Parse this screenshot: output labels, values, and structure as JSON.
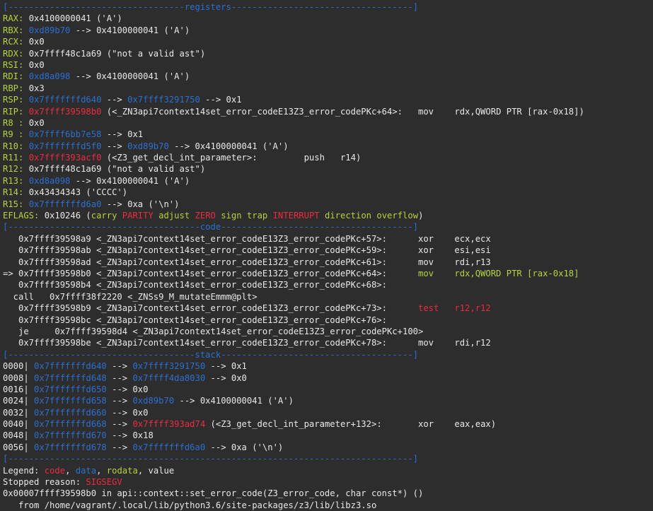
{
  "colors": {
    "blue": "#2c6fd1",
    "green": "#b5d33a",
    "red": "#ef2a3f",
    "white": "#e8e8e8",
    "background": "#2d2d2d"
  },
  "sections": {
    "registers": "registers",
    "code": "code",
    "stack": "stack"
  },
  "registers": [
    {
      "name": "RAX:",
      "segs": [
        {
          "c": "w",
          "t": " 0x4100000041 ('A')"
        }
      ]
    },
    {
      "name": "RBX:",
      "segs": [
        {
          "c": "b",
          "t": " 0xd89b70"
        },
        {
          "c": "w",
          "t": " --> 0x4100000041 ('A')"
        }
      ]
    },
    {
      "name": "RCX:",
      "segs": [
        {
          "c": "w",
          "t": " 0x0"
        }
      ]
    },
    {
      "name": "RDX:",
      "segs": [
        {
          "c": "w",
          "t": " 0x7ffff48c1a69 (\"not a valid ast\")"
        }
      ]
    },
    {
      "name": "RSI:",
      "segs": [
        {
          "c": "w",
          "t": " 0x0"
        }
      ]
    },
    {
      "name": "RDI:",
      "segs": [
        {
          "c": "b",
          "t": " 0xd8a098"
        },
        {
          "c": "w",
          "t": " --> 0x4100000041 ('A')"
        }
      ]
    },
    {
      "name": "RBP:",
      "segs": [
        {
          "c": "w",
          "t": " 0x3"
        }
      ]
    },
    {
      "name": "RSP:",
      "segs": [
        {
          "c": "b",
          "t": " 0x7fffffffd640"
        },
        {
          "c": "w",
          "t": " --> "
        },
        {
          "c": "b",
          "t": "0x7ffff3291750"
        },
        {
          "c": "w",
          "t": " --> 0x1"
        }
      ]
    },
    {
      "name": "RIP:",
      "segs": [
        {
          "c": "r",
          "t": " 0x7ffff39598b0"
        },
        {
          "c": "w",
          "t": " (<_ZN3api7context14set_error_codeE13Z3_error_codePKc+64>:   mov    rdx,QWORD PTR [rax-0x18])"
        }
      ]
    },
    {
      "name": "R8 :",
      "segs": [
        {
          "c": "w",
          "t": " 0x0"
        }
      ]
    },
    {
      "name": "R9 :",
      "segs": [
        {
          "c": "b",
          "t": " 0x7ffff6bb7e58"
        },
        {
          "c": "w",
          "t": " --> 0x1"
        }
      ]
    },
    {
      "name": "R10:",
      "segs": [
        {
          "c": "b",
          "t": " 0x7fffffffd5f0"
        },
        {
          "c": "w",
          "t": " --> "
        },
        {
          "c": "b",
          "t": "0xd89b70"
        },
        {
          "c": "w",
          "t": " --> 0x4100000041 ('A')"
        }
      ]
    },
    {
      "name": "R11:",
      "segs": [
        {
          "c": "r",
          "t": " 0x7ffff393acf0"
        },
        {
          "c": "w",
          "t": " (<Z3_get_decl_int_parameter>:         push   r14)"
        }
      ]
    },
    {
      "name": "R12:",
      "segs": [
        {
          "c": "w",
          "t": " 0x7ffff48c1a69 (\"not a valid ast\")"
        }
      ]
    },
    {
      "name": "R13:",
      "segs": [
        {
          "c": "b",
          "t": " 0xd8a098"
        },
        {
          "c": "w",
          "t": " --> 0x4100000041 ('A')"
        }
      ]
    },
    {
      "name": "R14:",
      "segs": [
        {
          "c": "w",
          "t": " 0x43434343 ('CCCC')"
        }
      ]
    },
    {
      "name": "R15:",
      "segs": [
        {
          "c": "b",
          "t": " 0x7fffffffd6a0"
        },
        {
          "c": "w",
          "t": " --> 0xa ('\\n')"
        }
      ]
    },
    {
      "name": "EFLAGS:",
      "segs": [
        {
          "c": "w",
          "t": " 0x10246 ("
        },
        {
          "c": "g",
          "t": "carry "
        },
        {
          "c": "r",
          "t": "PARITY"
        },
        {
          "c": "g",
          "t": " adjust "
        },
        {
          "c": "r",
          "t": "ZERO"
        },
        {
          "c": "g",
          "t": " sign trap "
        },
        {
          "c": "r",
          "t": "INTERRUPT"
        },
        {
          "c": "g",
          "t": " direction overflow"
        },
        {
          "c": "w",
          "t": ")"
        }
      ]
    }
  ],
  "code": [
    {
      "segs": [
        {
          "c": "w",
          "t": "   0x7ffff39598a9 <_ZN3api7context14set_error_codeE13Z3_error_codePKc+57>:      xor    ecx,ecx"
        }
      ]
    },
    {
      "segs": [
        {
          "c": "w",
          "t": "   0x7ffff39598ab <_ZN3api7context14set_error_codeE13Z3_error_codePKc+59>:      xor    esi,esi"
        }
      ]
    },
    {
      "segs": [
        {
          "c": "w",
          "t": "   0x7ffff39598ad <_ZN3api7context14set_error_codeE13Z3_error_codePKc+61>:      mov    rdi,r13"
        }
      ]
    },
    {
      "segs": [
        {
          "c": "w",
          "t": "=> 0x7ffff39598b0 <_ZN3api7context14set_error_codeE13Z3_error_codePKc+64>:      "
        },
        {
          "c": "g",
          "t": "mov    rdx,QWORD PTR [rax-0x18]"
        }
      ]
    },
    {
      "segs": [
        {
          "c": "w",
          "t": "   0x7ffff39598b4 <_ZN3api7context14set_error_codeE13Z3_error_codePKc+68>:"
        }
      ]
    },
    {
      "segs": [
        {
          "c": "w",
          "t": "  call   0x7ffff38f2220 <_ZNSs9_M_mutateEmmm@plt>"
        }
      ]
    },
    {
      "segs": [
        {
          "c": "w",
          "t": "   0x7ffff39598b9 <_ZN3api7context14set_error_codeE13Z3_error_codePKc+73>:      "
        },
        {
          "c": "r",
          "t": "test   r12,r12"
        }
      ]
    },
    {
      "segs": [
        {
          "c": "w",
          "t": "   0x7ffff39598bc <_ZN3api7context14set_error_codeE13Z3_error_codePKc+76>:"
        }
      ]
    },
    {
      "segs": [
        {
          "c": "w",
          "t": "   je     0x7ffff39598d4 <_ZN3api7context14set_error_codeE13Z3_error_codePKc+100>"
        }
      ]
    },
    {
      "segs": [
        {
          "c": "w",
          "t": "   0x7ffff39598be <_ZN3api7context14set_error_codeE13Z3_error_codePKc+78>:      mov    rdi,r12"
        }
      ]
    }
  ],
  "stack": [
    {
      "segs": [
        {
          "c": "w",
          "t": "0000| "
        },
        {
          "c": "b",
          "t": "0x7fffffffd640"
        },
        {
          "c": "w",
          "t": " --> "
        },
        {
          "c": "b",
          "t": "0x7ffff3291750"
        },
        {
          "c": "w",
          "t": " --> 0x1"
        }
      ]
    },
    {
      "segs": [
        {
          "c": "w",
          "t": "0008| "
        },
        {
          "c": "b",
          "t": "0x7fffffffd648"
        },
        {
          "c": "w",
          "t": " --> "
        },
        {
          "c": "b",
          "t": "0x7ffff4da8030"
        },
        {
          "c": "w",
          "t": " --> 0x0"
        }
      ]
    },
    {
      "segs": [
        {
          "c": "w",
          "t": "0016| "
        },
        {
          "c": "b",
          "t": "0x7fffffffd650"
        },
        {
          "c": "w",
          "t": " --> 0x0"
        }
      ]
    },
    {
      "segs": [
        {
          "c": "w",
          "t": "0024| "
        },
        {
          "c": "b",
          "t": "0x7fffffffd658"
        },
        {
          "c": "w",
          "t": " --> "
        },
        {
          "c": "b",
          "t": "0xd89b70"
        },
        {
          "c": "w",
          "t": " --> 0x4100000041 ('A')"
        }
      ]
    },
    {
      "segs": [
        {
          "c": "w",
          "t": "0032| "
        },
        {
          "c": "b",
          "t": "0x7fffffffd660"
        },
        {
          "c": "w",
          "t": " --> 0x0"
        }
      ]
    },
    {
      "segs": [
        {
          "c": "w",
          "t": "0040| "
        },
        {
          "c": "b",
          "t": "0x7fffffffd668"
        },
        {
          "c": "w",
          "t": " --> "
        },
        {
          "c": "r",
          "t": "0x7ffff393ad74"
        },
        {
          "c": "w",
          "t": " (<Z3_get_decl_int_parameter+132>:       xor    eax,eax)"
        }
      ]
    },
    {
      "segs": [
        {
          "c": "w",
          "t": "0048| "
        },
        {
          "c": "b",
          "t": "0x7fffffffd670"
        },
        {
          "c": "w",
          "t": " --> 0x18"
        }
      ]
    },
    {
      "segs": [
        {
          "c": "w",
          "t": "0056| "
        },
        {
          "c": "b",
          "t": "0x7fffffffd678"
        },
        {
          "c": "w",
          "t": " --> "
        },
        {
          "c": "b",
          "t": "0x7fffffffd6a0"
        },
        {
          "c": "w",
          "t": " --> 0xa ('\\n')"
        }
      ]
    }
  ],
  "legend": {
    "label": "Legend: ",
    "code": "code",
    "data": "data",
    "rodata": "rodata",
    "value": "value",
    "sep": ", "
  },
  "stopped": {
    "label": "Stopped reason: ",
    "reason": "SIGSEGV"
  },
  "footer": [
    "0x00007ffff39598b0 in api::context::set_error_code(Z3_error_code, char const*) ()",
    "   from /home/vagrant/.local/lib/python3.6/site-packages/z3/lib/libz3.so"
  ]
}
